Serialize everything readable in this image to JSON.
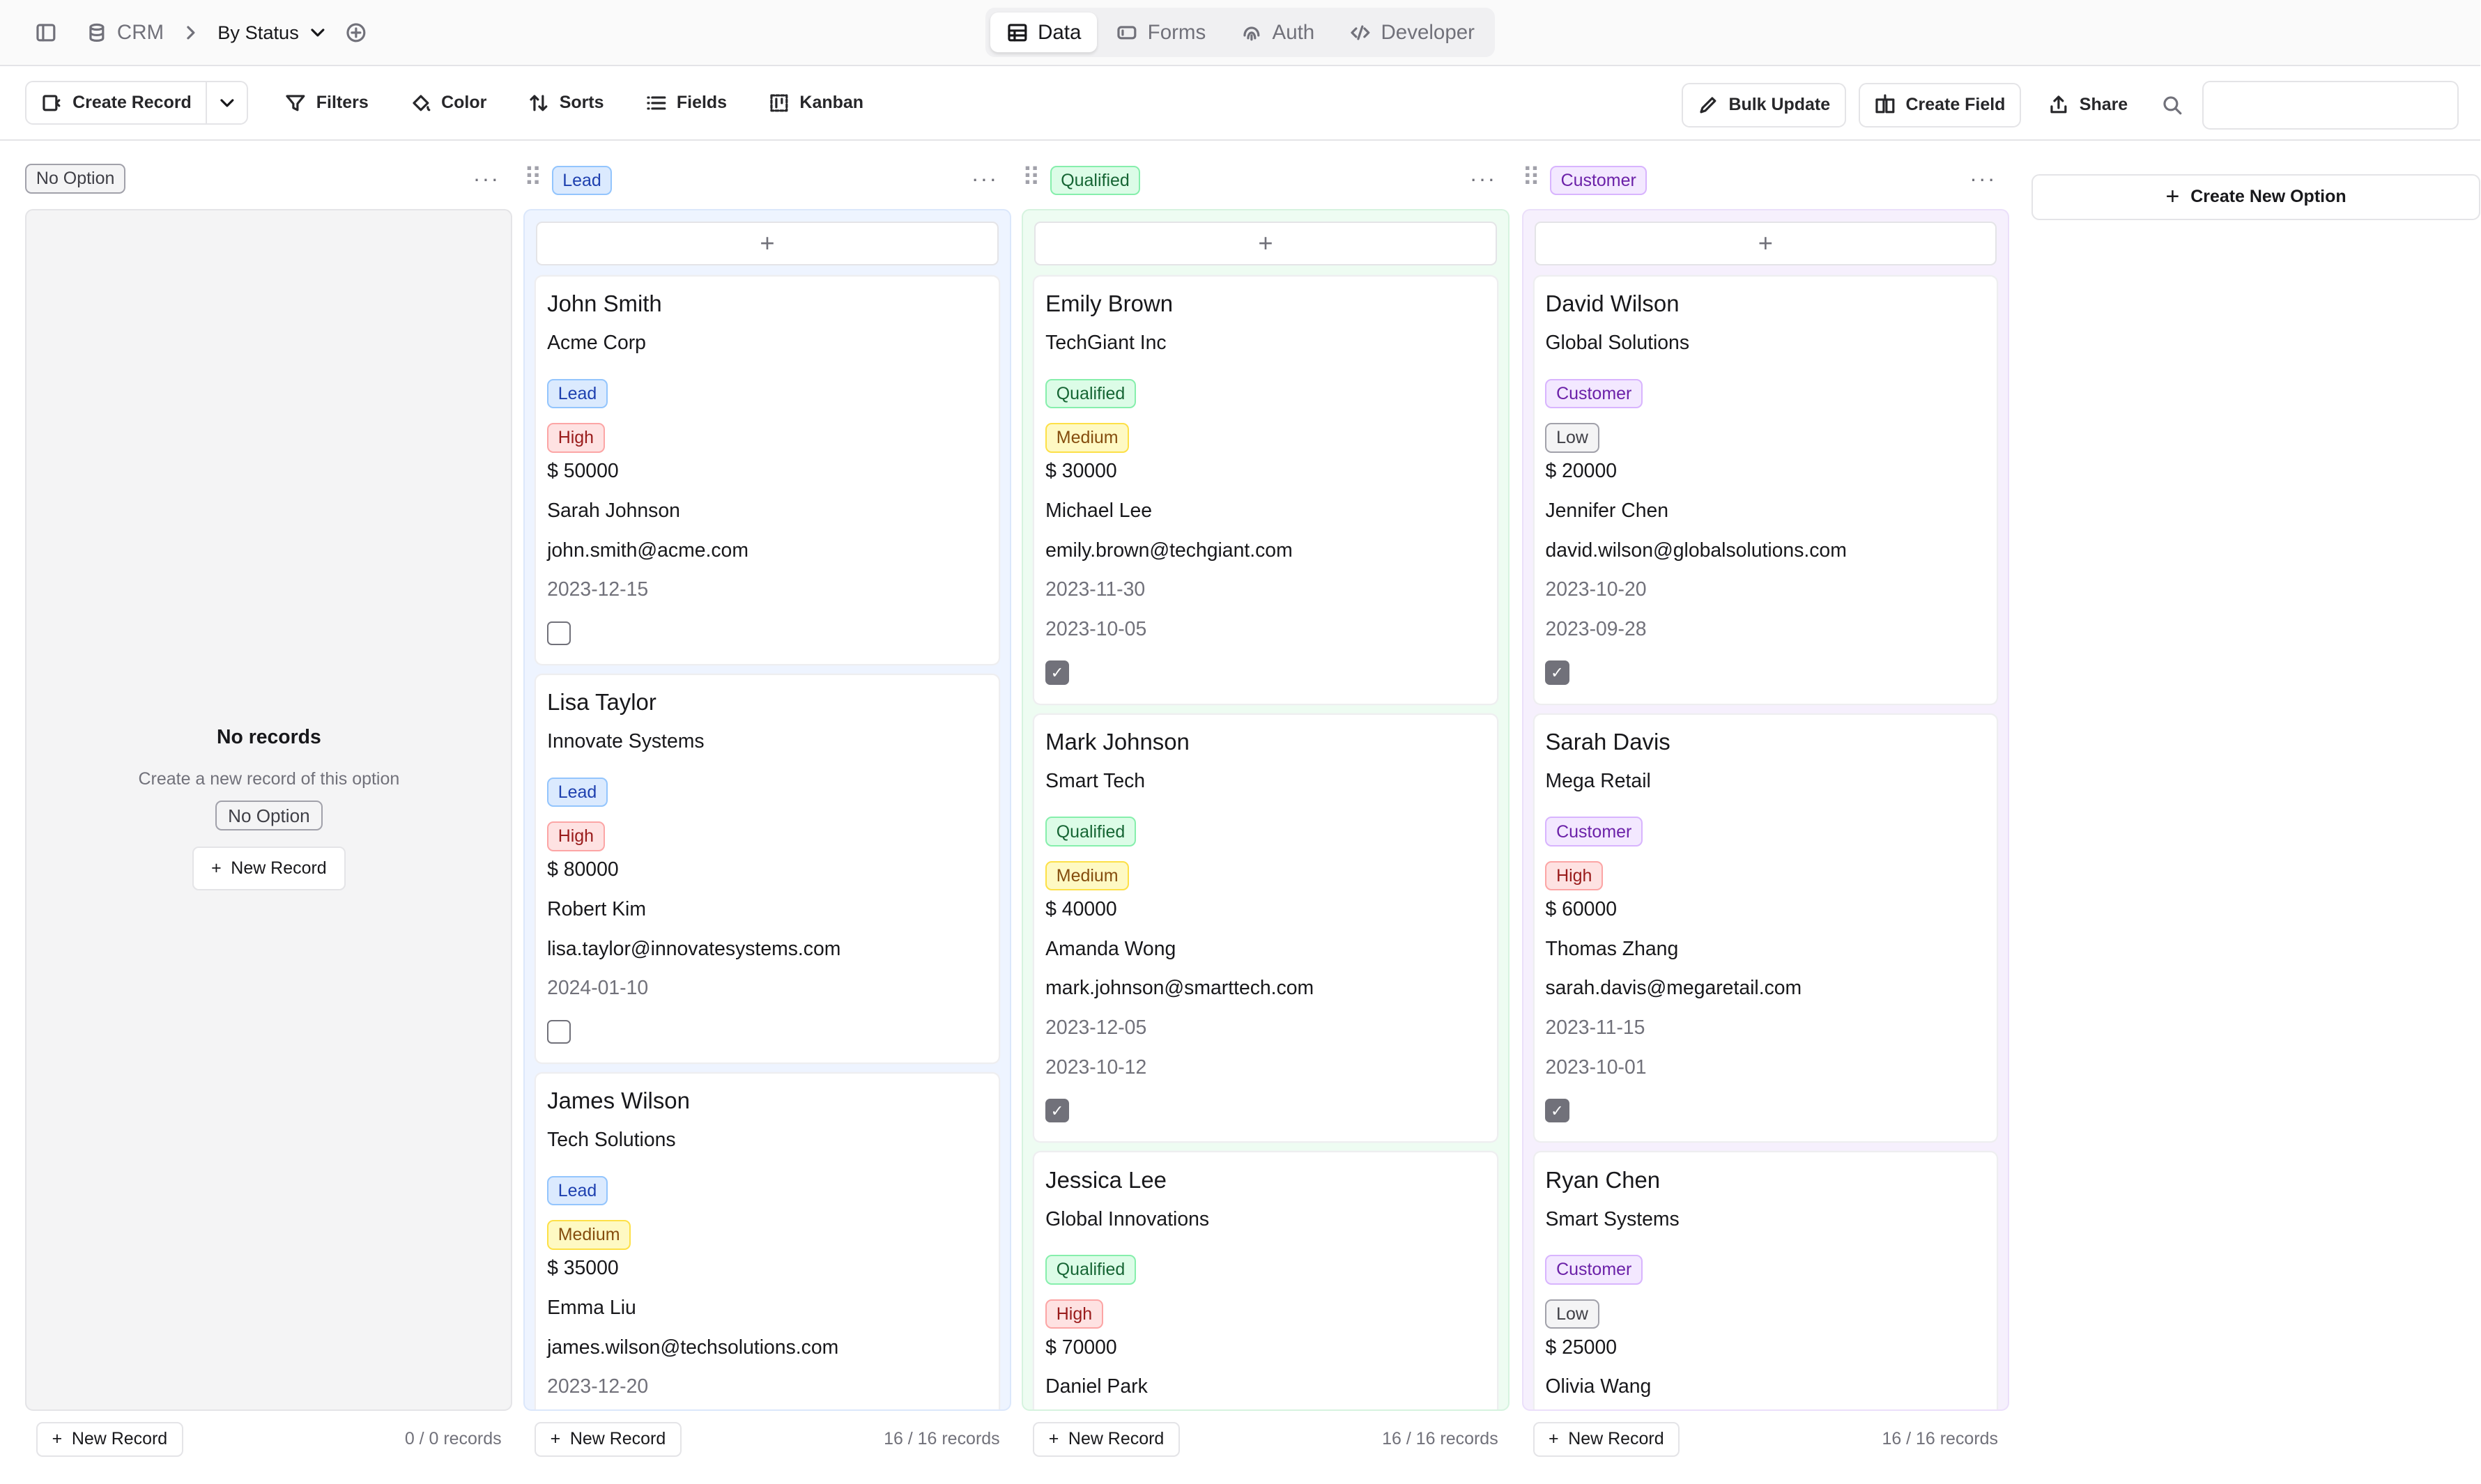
{
  "breadcrumb": {
    "app": "CRM",
    "view": "By Status"
  },
  "tabs": [
    {
      "label": "Data"
    },
    {
      "label": "Forms"
    },
    {
      "label": "Auth"
    },
    {
      "label": "Developer"
    }
  ],
  "toolbar": {
    "create_record": "Create Record",
    "filters": "Filters",
    "color": "Color",
    "sorts": "Sorts",
    "fields": "Fields",
    "kanban": "Kanban",
    "bulk_update": "Bulk Update",
    "create_field": "Create Field",
    "share": "Share",
    "search_value": ""
  },
  "columns": [
    {
      "label": "No Option",
      "count": "0 / 0 records"
    },
    {
      "label": "Lead",
      "count": "16 / 16 records"
    },
    {
      "label": "Qualified",
      "count": "16 / 16 records"
    },
    {
      "label": "Customer",
      "count": "16 / 16 records"
    }
  ],
  "empty": {
    "title": "No records",
    "subtitle": "Create a new record of this option",
    "tag": "No Option",
    "button": "New Record"
  },
  "new_record": "New Record",
  "create_new_option": "Create New Option",
  "cards": {
    "lead": [
      {
        "name": "John Smith",
        "company": "Acme Corp",
        "status": "Lead",
        "priority": "High",
        "value": "$ 50000",
        "contact": "Sarah Johnson",
        "email": "john.smith@acme.com",
        "date1": "2023-12-15",
        "date2": "",
        "checked": false
      },
      {
        "name": "Lisa Taylor",
        "company": "Innovate Systems",
        "status": "Lead",
        "priority": "High",
        "value": "$ 80000",
        "contact": "Robert Kim",
        "email": "lisa.taylor@innovatesystems.com",
        "date1": "2024-01-10",
        "date2": "",
        "checked": false
      },
      {
        "name": "James Wilson",
        "company": "Tech Solutions",
        "status": "Lead",
        "priority": "Medium",
        "value": "$ 35000",
        "contact": "Emma Liu",
        "email": "james.wilson@techsolutions.com",
        "date1": "2023-12-20",
        "date2": "",
        "checked": false
      }
    ],
    "qual": [
      {
        "name": "Emily Brown",
        "company": "TechGiant Inc",
        "status": "Qualified",
        "priority": "Medium",
        "value": "$ 30000",
        "contact": "Michael Lee",
        "email": "emily.brown@techgiant.com",
        "date1": "2023-11-30",
        "date2": "2023-10-05",
        "checked": true
      },
      {
        "name": "Mark Johnson",
        "company": "Smart Tech",
        "status": "Qualified",
        "priority": "Medium",
        "value": "$ 40000",
        "contact": "Amanda Wong",
        "email": "mark.johnson@smarttech.com",
        "date1": "2023-12-05",
        "date2": "2023-10-12",
        "checked": true
      },
      {
        "name": "Jessica Lee",
        "company": "Global Innovations",
        "status": "Qualified",
        "priority": "High",
        "value": "$ 70000",
        "contact": "Daniel Park",
        "email": "",
        "date1": "",
        "date2": "",
        "checked": false
      }
    ],
    "cust": [
      {
        "name": "David Wilson",
        "company": "Global Solutions",
        "status": "Customer",
        "priority": "Low",
        "value": "$ 20000",
        "contact": "Jennifer Chen",
        "email": "david.wilson@globalsolutions.com",
        "date1": "2023-10-20",
        "date2": "2023-09-28",
        "checked": true
      },
      {
        "name": "Sarah Davis",
        "company": "Mega Retail",
        "status": "Customer",
        "priority": "High",
        "value": "$ 60000",
        "contact": "Thomas Zhang",
        "email": "sarah.davis@megaretail.com",
        "date1": "2023-11-15",
        "date2": "2023-10-01",
        "checked": true
      },
      {
        "name": "Ryan Chen",
        "company": "Smart Systems",
        "status": "Customer",
        "priority": "Low",
        "value": "$ 25000",
        "contact": "Olivia Wang",
        "email": "",
        "date1": "",
        "date2": "",
        "checked": false
      }
    ]
  }
}
